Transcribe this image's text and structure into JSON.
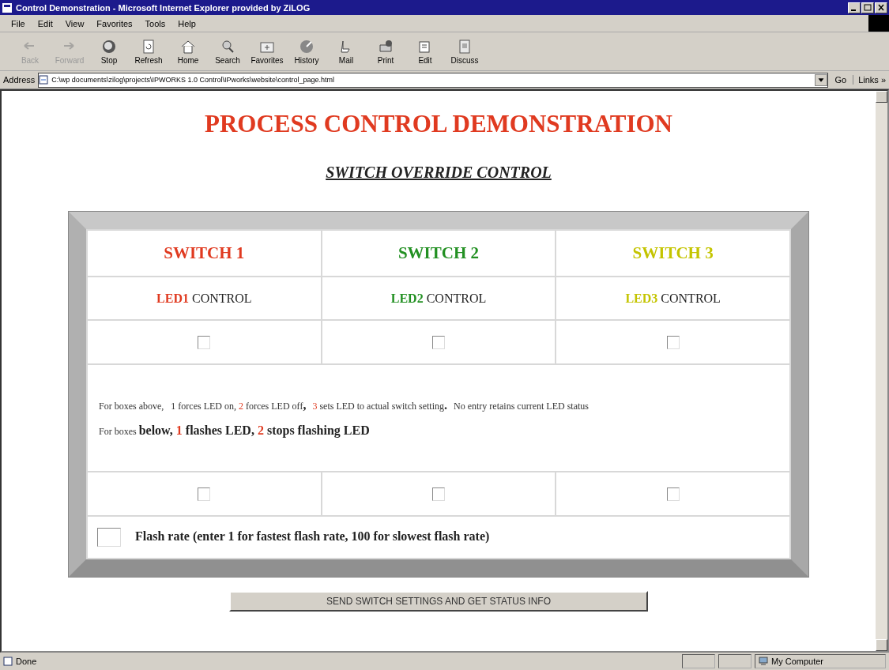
{
  "window": {
    "title": "Control Demonstration - Microsoft Internet Explorer provided by ZiLOG"
  },
  "menu": [
    "File",
    "Edit",
    "View",
    "Favorites",
    "Tools",
    "Help"
  ],
  "toolbar": [
    {
      "label": "Back",
      "kind": "back",
      "disabled": true
    },
    {
      "label": "Forward",
      "kind": "forward",
      "disabled": true
    },
    {
      "label": "Stop",
      "kind": "stop",
      "disabled": false
    },
    {
      "label": "Refresh",
      "kind": "refresh",
      "disabled": false
    },
    {
      "label": "Home",
      "kind": "home",
      "disabled": false
    },
    {
      "label": "Search",
      "kind": "search",
      "disabled": false
    },
    {
      "label": "Favorites",
      "kind": "favorites",
      "disabled": false
    },
    {
      "label": "History",
      "kind": "history",
      "disabled": false
    },
    {
      "label": "Mail",
      "kind": "mail",
      "disabled": false
    },
    {
      "label": "Print",
      "kind": "print",
      "disabled": false
    },
    {
      "label": "Edit",
      "kind": "edit",
      "disabled": false
    },
    {
      "label": "Discuss",
      "kind": "discuss",
      "disabled": false
    }
  ],
  "address": {
    "label": "Address",
    "value": "C:\\wp documents\\zilog\\projects\\IPWORKS 1.0 Control\\IPworks\\website\\control_page.html",
    "go": "Go",
    "links": "Links »"
  },
  "page": {
    "heading": "PROCESS CONTROL DEMONSTRATION",
    "subheading": "SWITCH OVERRIDE CONTROL",
    "switches": [
      {
        "name": "SWITCH 1",
        "led": "LED1",
        "control": "CONTROL",
        "color": "#e03a20"
      },
      {
        "name": "SWITCH 2",
        "led": "LED2",
        "control": "CONTROL",
        "color": "#229022"
      },
      {
        "name": "SWITCH 3",
        "led": "LED3",
        "control": "CONTROL",
        "color": "#c4c400"
      }
    ],
    "instructions": [
      [
        {
          "text": "For boxes above,   1 forces LED on, ",
          "kind": "plain"
        },
        {
          "text": "2",
          "kind": "number"
        },
        {
          "text": " forces LED off",
          "kind": "plain"
        },
        {
          "text": ",  ",
          "kind": "strong"
        },
        {
          "text": "3",
          "kind": "number"
        },
        {
          "text": " sets LED to actual switch setting",
          "kind": "plain"
        },
        {
          "text": ".  ",
          "kind": "strong"
        },
        {
          "text": "No entry retains current LED status",
          "kind": "plain"
        }
      ],
      [
        {
          "text": "For boxes ",
          "kind": "plain"
        },
        {
          "text": "below, ",
          "kind": "strong"
        },
        {
          "text": "1",
          "kind": "strong_number"
        },
        {
          "text": " flashes LED, ",
          "kind": "strong"
        },
        {
          "text": "2",
          "kind": "strong_number"
        },
        {
          "text": " stops flashing LED",
          "kind": "strong"
        }
      ]
    ],
    "flash_rate_label": "Flash rate (enter 1 for fastest flash rate, 100 for slowest flash rate)",
    "submit": "SEND SWITCH SETTINGS AND GET STATUS INFO"
  },
  "status_bar": {
    "text": "Done",
    "zone": "My Computer"
  }
}
